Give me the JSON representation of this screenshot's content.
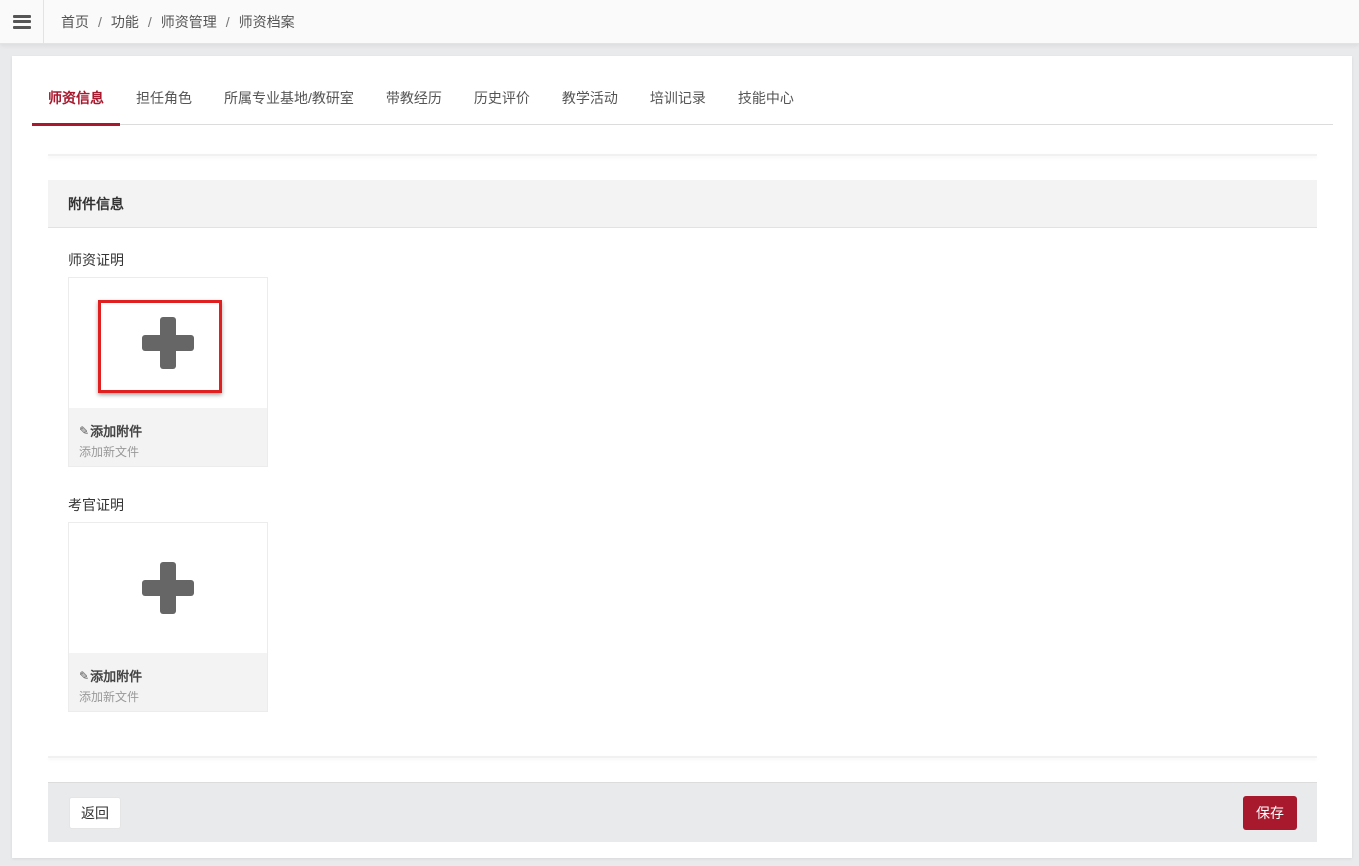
{
  "breadcrumb": [
    "首页",
    "功能",
    "师资管理",
    "师资档案"
  ],
  "breadcrumb_separator": "/",
  "tabs": [
    {
      "label": "师资信息",
      "active": true
    },
    {
      "label": "担任角色",
      "active": false
    },
    {
      "label": "所属专业基地/教研室",
      "active": false
    },
    {
      "label": "带教经历",
      "active": false
    },
    {
      "label": "历史评价",
      "active": false
    },
    {
      "label": "教学活动",
      "active": false
    },
    {
      "label": "培训记录",
      "active": false
    },
    {
      "label": "技能中心",
      "active": false
    }
  ],
  "section": {
    "title": "附件信息"
  },
  "attachments": [
    {
      "label": "师资证明",
      "add_title": "添加附件",
      "add_subtitle": "添加新文件",
      "highlighted": true
    },
    {
      "label": "考官证明",
      "add_title": "添加附件",
      "add_subtitle": "添加新文件",
      "highlighted": false
    }
  ],
  "actions": {
    "back_label": "返回",
    "save_label": "保存"
  },
  "colors": {
    "accent": "#a8192e",
    "highlight_border": "#e02020"
  },
  "icons": {
    "menu": "hamburger-menu-icon",
    "add": "plus-icon",
    "attachment": "paperclip-icon"
  }
}
